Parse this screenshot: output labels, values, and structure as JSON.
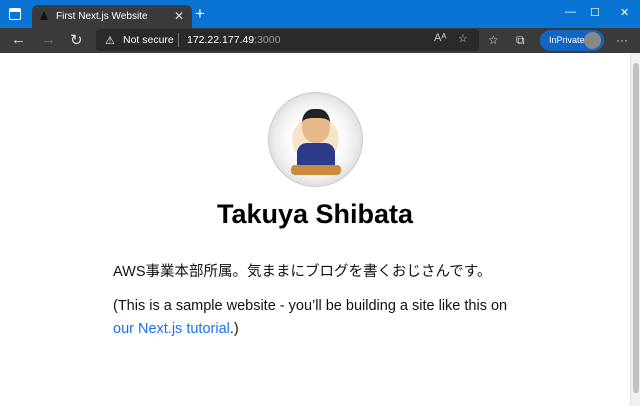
{
  "browser": {
    "tab_title": "First Next.js Website",
    "security": "Not secure",
    "url_host": "172.22.177.49",
    "url_port": ":3000",
    "inprivate": "InPrivate"
  },
  "page": {
    "name": "Takuya Shibata",
    "bio": "AWS事業本部所属。気ままにブログを書くおじさんです。",
    "note_before": "(This is a sample website - you’ll be building a site like this on ",
    "link": "our Next.js tutorial",
    "note_after": ".)"
  }
}
